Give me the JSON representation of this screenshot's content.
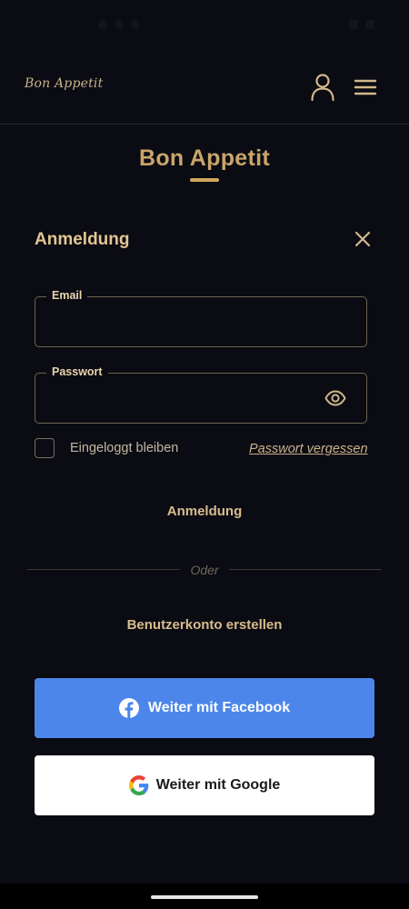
{
  "header": {
    "logo_text": "Bon Appetit",
    "icons": [
      "user-icon",
      "hamburger-menu-icon"
    ]
  },
  "page": {
    "title": "Bon Appetit"
  },
  "login_dialog": {
    "title": "Anmeldung",
    "email": {
      "label": "Email",
      "value": "",
      "placeholder": ""
    },
    "password": {
      "label": "Passwort",
      "value": "",
      "placeholder": ""
    },
    "remember_label": "Eingeloggt bleiben",
    "remember_checked": false,
    "forgot_password": "Passwort vergessen",
    "login_button": "Anmeldung",
    "divider_text": "Oder",
    "register_button": "Benutzerkonto erstellen",
    "facebook_button": "Weiter mit Facebook",
    "google_button": "Weiter mit Google"
  },
  "colors": {
    "background": "#0b0b13",
    "accent": "#c9a56a",
    "facebook": "#4c86ea",
    "google_button_bg": "#ffffff"
  }
}
